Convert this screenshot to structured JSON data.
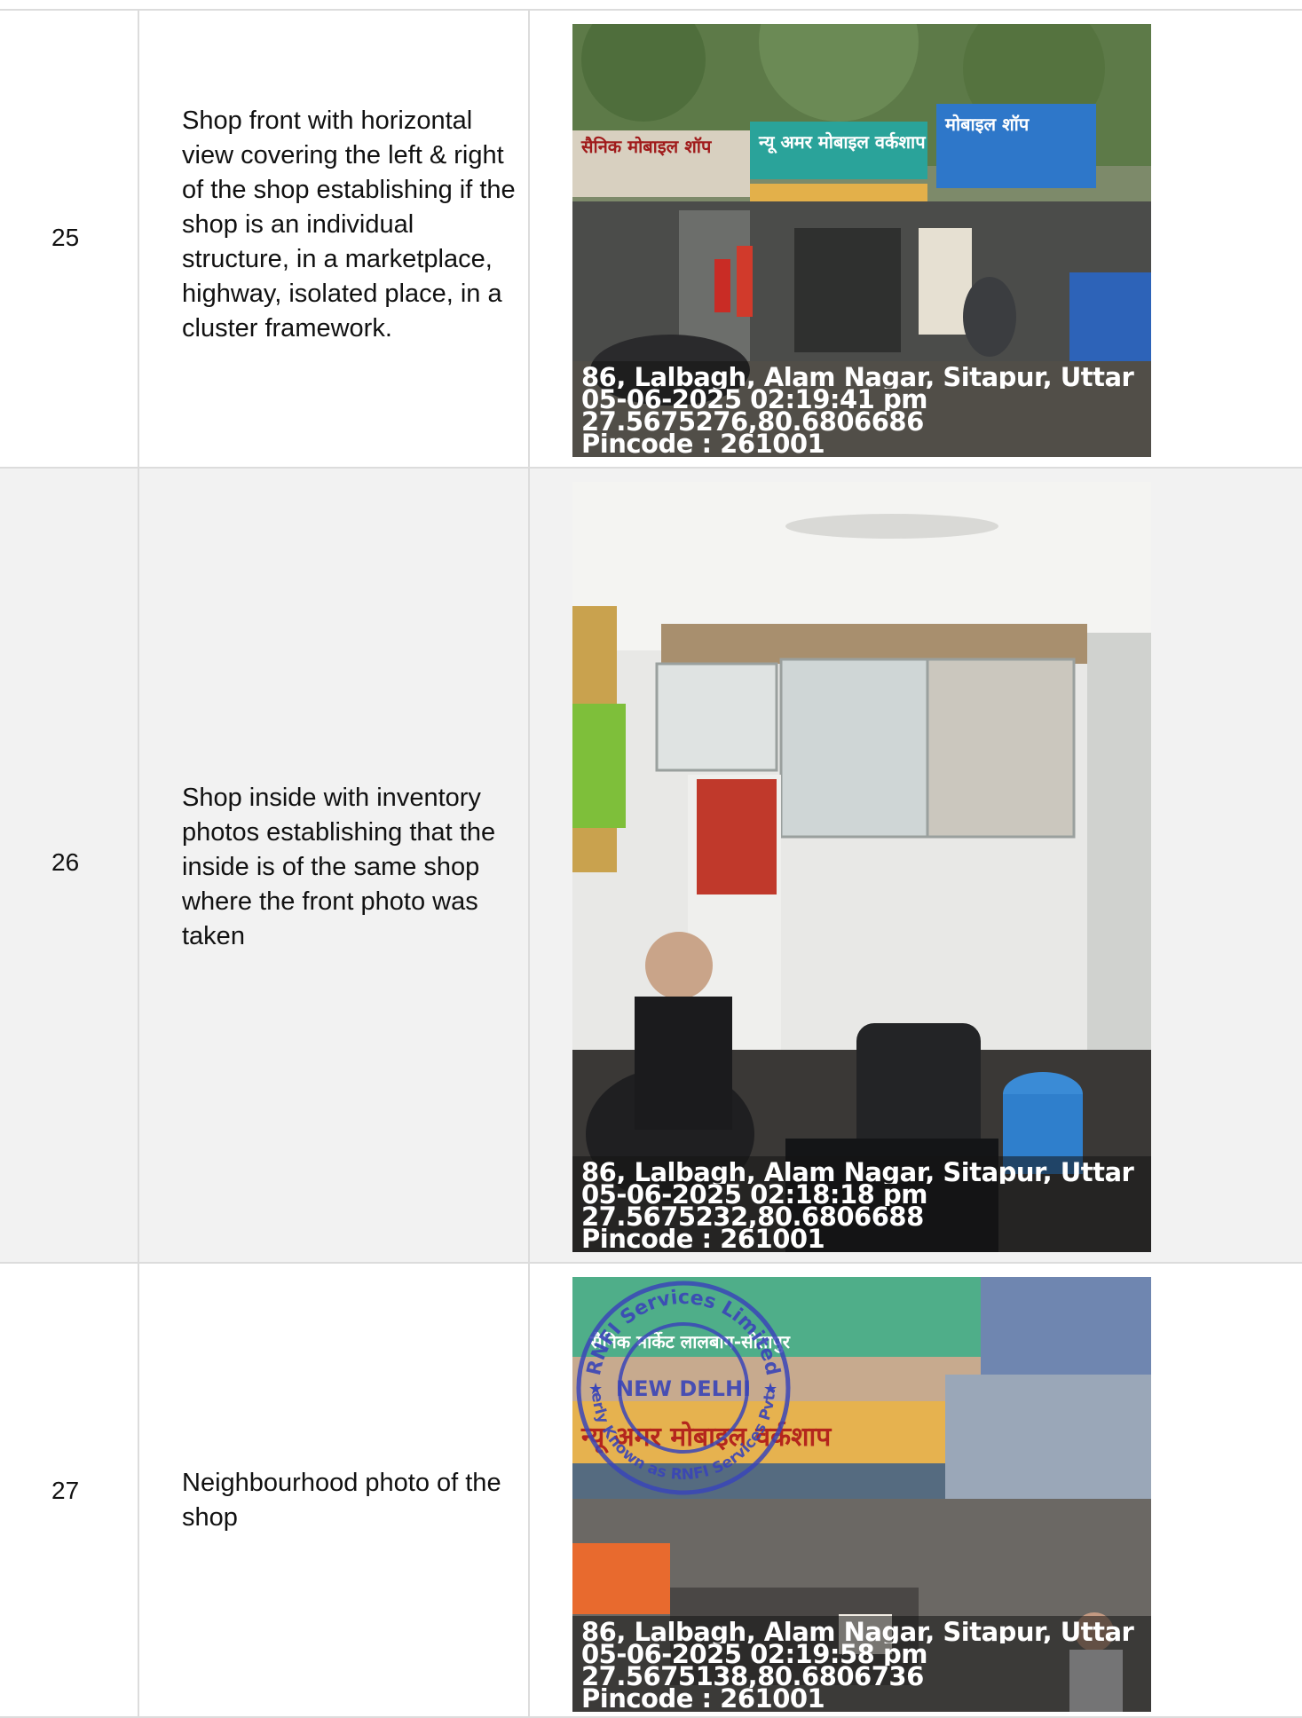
{
  "rows": [
    {
      "number": "25",
      "description": "Shop front with horizontal view covering the left & right of the shop establishing if the shop is an individual structure, in a marketplace, highway, isolated place, in a cluster framework.",
      "photo": {
        "address": "86, Lalbagh, Alam Nagar, Sitapur, Uttar ...",
        "datetime": "05-06-2025 02:19:41 pm",
        "coordinates": "27.5675276,80.6806686",
        "pincode": "Pincode : 261001",
        "signs": [
          "सैनिक मोबाइल शॉप",
          "न्यू अमर मोबाइल वर्कशाप",
          "मोबाइल शॉप"
        ]
      }
    },
    {
      "number": "26",
      "description": "Shop inside with inventory photos establishing that the inside is of the same shop where the front photo was taken",
      "photo": {
        "address": "86, Lalbagh, Alam Nagar, Sitapur, Uttar ...",
        "datetime": "05-06-2025 02:18:18 pm",
        "coordinates": "27.5675232,80.6806688",
        "pincode": "Pincode : 261001"
      }
    },
    {
      "number": "27",
      "description": "Neighbourhood photo of the shop",
      "photo": {
        "address": "86, Lalbagh, Alam Nagar, Sitapur, Uttar ...",
        "datetime": "05-06-2025 02:19:58 pm",
        "coordinates": "27.5675138,80.6806736",
        "pincode": "Pincode : 261001",
        "signs": [
          "सैनिक मार्केट लालबाग-सीतापुर",
          "न्यू अमर मोबाइल वर्कशाप"
        ],
        "stamp": {
          "outer_text_top": "RNFI Services Limited",
          "outer_text_bottom": "(Formerly Known as RNFI Services Pvt. Ltd.)",
          "center_text": "NEW DELHI"
        }
      }
    }
  ]
}
